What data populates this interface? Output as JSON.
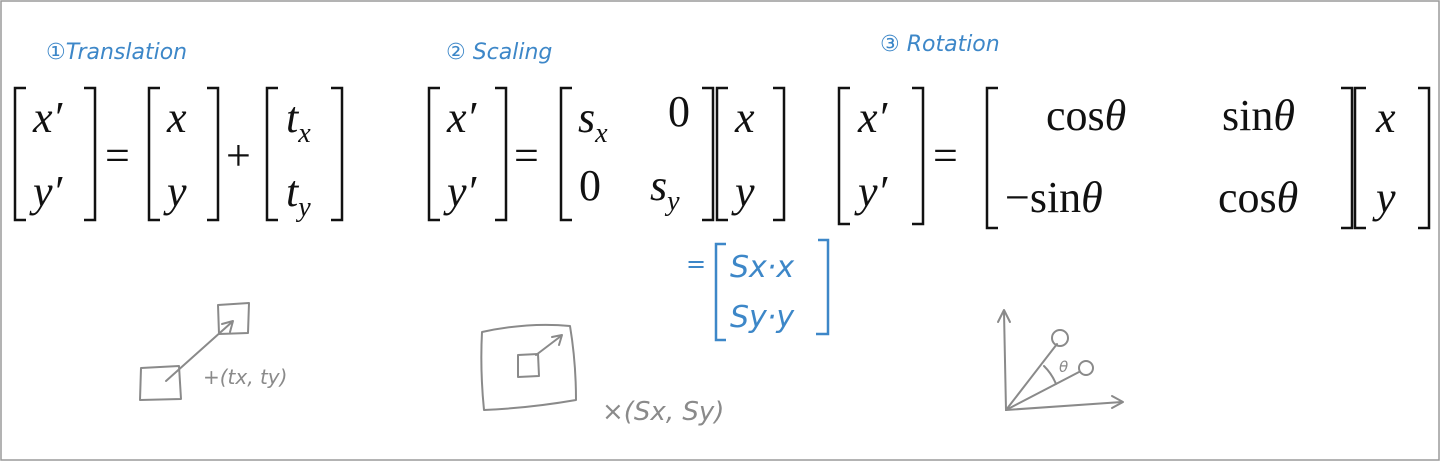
{
  "colors": {
    "ink": "#111111",
    "blue": "#3d87c8",
    "sketch": "#8a8a8a",
    "border": "#9a9a9a"
  },
  "headings": {
    "translation": "①Translation",
    "scaling": "② Scaling",
    "rotation": "③ Rotation"
  },
  "translation": {
    "lhs": [
      "x′",
      "y′"
    ],
    "equals": "=",
    "vec": [
      "x",
      "y"
    ],
    "plus": "+",
    "t": {
      "base": "t",
      "sub_x": "x",
      "sub_y": "y"
    },
    "annotation": "+(tx, ty)"
  },
  "scaling": {
    "lhs": [
      "x′",
      "y′"
    ],
    "equals": "=",
    "matrix": {
      "s": "s",
      "sub_x": "x",
      "sub_y": "y",
      "zero": "0"
    },
    "vec": [
      "x",
      "y"
    ],
    "result": {
      "equals": "=",
      "row1": "Sx·x",
      "row2": "Sy·y"
    },
    "annotation": "×(Sx, Sy)"
  },
  "rotation": {
    "lhs": [
      "x′",
      "y′"
    ],
    "equals": "=",
    "m11": "cos",
    "m12": "sin",
    "m21": "−sin",
    "m22": "cos",
    "theta": "θ",
    "vec": [
      "x",
      "y"
    ],
    "sketch_label": "θ"
  }
}
